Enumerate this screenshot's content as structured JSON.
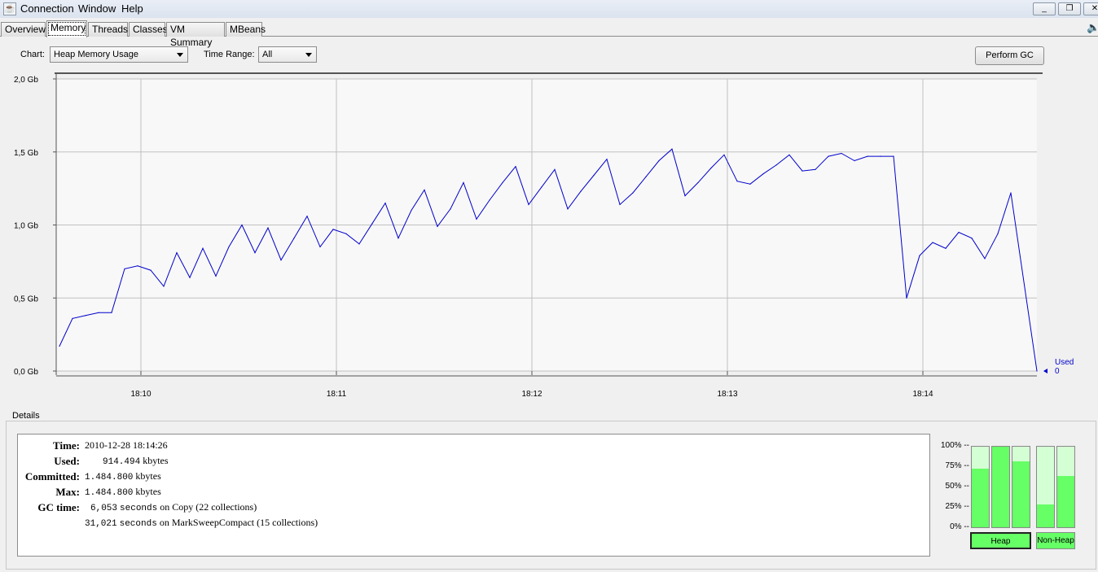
{
  "menu": {
    "items": [
      "Connection",
      "Window",
      "Help"
    ],
    "app_icon": "java-cup-icon"
  },
  "window_controls": {
    "minimize": "_",
    "restore": "❐",
    "close": "✕"
  },
  "tabs": [
    "Overview",
    "Memory",
    "Threads",
    "Classes",
    "VM Summary",
    "MBeans"
  ],
  "selected_tab": "Memory",
  "controls": {
    "chart_label": "Chart:",
    "chart_value": "Heap Memory Usage",
    "time_range_label": "Time Range:",
    "time_range_value": "All",
    "perform_gc": "Perform GC"
  },
  "chart_data": {
    "type": "line",
    "ylabel": "",
    "xlabel": "",
    "y_tick_labels": [
      "0,0 Gb",
      "0,5 Gb",
      "1,0 Gb",
      "1,5 Gb",
      "2,0 Gb"
    ],
    "y_ticks": [
      0,
      0.5,
      1.0,
      1.5,
      2.0
    ],
    "ylim": [
      0,
      2.0
    ],
    "x_tick_labels": [
      "18:10",
      "18:11",
      "18:12",
      "18:13",
      "18:14"
    ],
    "xlim": [
      "18:09:34",
      "18:14:35"
    ],
    "grid": true,
    "legend_placement": "right",
    "series": [
      {
        "name": "Used",
        "last_value_label": "0",
        "color": "#0000cc",
        "x": [
          "18:09:35",
          "18:09:39",
          "18:09:43",
          "18:09:47",
          "18:09:51",
          "18:09:55",
          "18:09:59",
          "18:10:03",
          "18:10:07",
          "18:10:11",
          "18:10:15",
          "18:10:19",
          "18:10:23",
          "18:10:27",
          "18:10:31",
          "18:10:35",
          "18:10:39",
          "18:10:43",
          "18:10:47",
          "18:10:51",
          "18:10:55",
          "18:10:59",
          "18:11:03",
          "18:11:07",
          "18:11:11",
          "18:11:15",
          "18:11:19",
          "18:11:23",
          "18:11:27",
          "18:11:31",
          "18:11:35",
          "18:11:39",
          "18:11:43",
          "18:11:47",
          "18:11:51",
          "18:11:55",
          "18:11:59",
          "18:12:03",
          "18:12:07",
          "18:12:11",
          "18:12:15",
          "18:12:19",
          "18:12:23",
          "18:12:27",
          "18:12:31",
          "18:12:35",
          "18:12:39",
          "18:12:43",
          "18:12:47",
          "18:12:51",
          "18:12:55",
          "18:12:59",
          "18:13:03",
          "18:13:07",
          "18:13:11",
          "18:13:15",
          "18:13:19",
          "18:13:23",
          "18:13:27",
          "18:13:31",
          "18:13:35",
          "18:13:39",
          "18:13:43",
          "18:13:47",
          "18:13:51",
          "18:13:55",
          "18:13:59",
          "18:14:03",
          "18:14:07",
          "18:14:11",
          "18:14:15",
          "18:14:19",
          "18:14:23",
          "18:14:27",
          "18:14:35"
        ],
        "values": [
          0.17,
          0.36,
          0.38,
          0.4,
          0.4,
          0.7,
          0.72,
          0.69,
          0.58,
          0.81,
          0.64,
          0.84,
          0.65,
          0.85,
          1.0,
          0.81,
          0.98,
          0.76,
          0.91,
          1.06,
          0.85,
          0.97,
          0.94,
          0.87,
          1.01,
          1.15,
          0.91,
          1.1,
          1.24,
          0.99,
          1.11,
          1.29,
          1.04,
          1.17,
          1.29,
          1.4,
          1.14,
          1.26,
          1.38,
          1.11,
          1.23,
          1.34,
          1.45,
          1.14,
          1.22,
          1.33,
          1.44,
          1.52,
          1.2,
          1.29,
          1.39,
          1.48,
          1.3,
          1.28,
          1.35,
          1.41,
          1.48,
          1.37,
          1.38,
          1.47,
          1.49,
          1.44,
          1.47,
          1.47,
          1.47,
          0.5,
          0.79,
          0.88,
          0.84,
          0.95,
          0.91,
          0.77,
          0.94,
          1.22,
          0.0
        ]
      }
    ]
  },
  "details": {
    "title": "Details",
    "time_label": "Time:",
    "time": "2010-12-28 18:14:26",
    "used_label": "Used:",
    "used": "914.494",
    "used_unit": "kbytes",
    "committed_label": "Committed:",
    "committed": "1.484.800",
    "committed_unit": "kbytes",
    "max_label": "Max:",
    "max": "1.484.800",
    "max_unit": "kbytes",
    "gc_label": "GC time:",
    "gc": [
      {
        "seconds": "6,053",
        "unit": "seconds",
        "text": "on Copy (22 collections)"
      },
      {
        "seconds": "31,021",
        "unit": "seconds",
        "text": "on MarkSweepCompact (15 collections)"
      }
    ]
  },
  "pools": {
    "pct_labels": [
      "100% --",
      "75% --",
      "50% --",
      "25% --",
      "0% --"
    ],
    "bars_used_percent": [
      73,
      100,
      82,
      28,
      64
    ],
    "heap_label": "Heap",
    "nonheap_label": "Non-Heap",
    "used_color": "#66ff66",
    "committed_color": "#d4fed4"
  }
}
